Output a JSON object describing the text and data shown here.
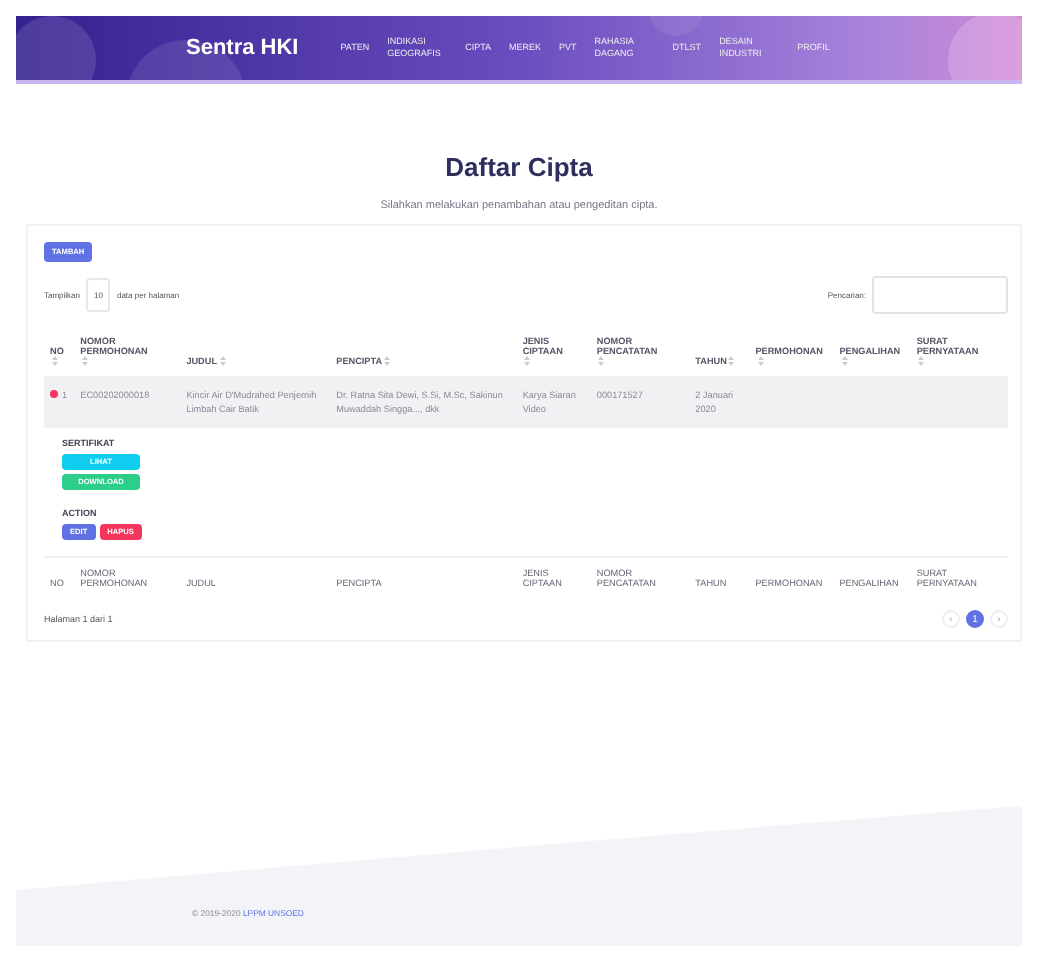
{
  "navbar": {
    "brand": "Sentra HKI",
    "items": [
      {
        "label": "PATEN"
      },
      {
        "label": "INDIKASI GEOGRAFIS"
      },
      {
        "label": "CIPTA"
      },
      {
        "label": "MEREK"
      },
      {
        "label": "PVT"
      },
      {
        "label": "RAHASIA DAGANG"
      },
      {
        "label": "DTLST"
      },
      {
        "label": "DESAIN INDUSTRI"
      },
      {
        "label": "PROFIL"
      }
    ]
  },
  "page": {
    "title": "Daftar Cipta",
    "subtitle": "Silahkan melakukan penambahan atau pengeditan cipta."
  },
  "add_button": "TAMBAH",
  "length_control": {
    "before": "Tampilkan",
    "value": "10",
    "after": "data per halaman"
  },
  "search": {
    "label": "Pencarian:"
  },
  "table": {
    "columns": [
      {
        "label": "NO"
      },
      {
        "label": "NOMOR PERMOHONAN"
      },
      {
        "label": "JUDUL"
      },
      {
        "label": "PENCIPTA"
      },
      {
        "label": "JENIS CIPTAAN"
      },
      {
        "label": "NOMOR PENCATATAN"
      },
      {
        "label": "TAHUN"
      },
      {
        "label": "PERMOHONAN"
      },
      {
        "label": "PENGALIHAN"
      },
      {
        "label": "SURAT PERNYATAAN"
      }
    ],
    "rows": [
      {
        "expanded": true,
        "cells": [
          "1",
          "EC00202000018",
          "Kincir Air D'Mudrahed Penjernih Limbah Cair Batik",
          "Dr. Ratna Sita Dewi, S.Si, M.Sc, Sakinun Muwaddah Singga..., dkk",
          "Karya Siaran Video",
          "000171527",
          "2 Januari 2020",
          "",
          "",
          ""
        ],
        "details": [
          {
            "label": "SERTIFIKAT",
            "buttons": [
              {
                "label": "LIHAT",
                "kind": "info"
              },
              {
                "label": "DOWNLOAD",
                "kind": "success"
              }
            ],
            "kind": "stacked"
          },
          {
            "label": "ACTION",
            "buttons": [
              {
                "label": "EDIT",
                "kind": "primary"
              },
              {
                "label": "HAPUS",
                "kind": "danger"
              }
            ],
            "kind": "inline"
          }
        ]
      }
    ],
    "footer_columns": [
      {
        "label": "NO"
      },
      {
        "label": "NOMOR PERMOHONAN"
      },
      {
        "label": "JUDUL"
      },
      {
        "label": "PENCIPTA"
      },
      {
        "label": "JENIS CIPTAAN"
      },
      {
        "label": "NOMOR PENCATATAN"
      },
      {
        "label": "TAHUN"
      },
      {
        "label": "PERMOHONAN"
      },
      {
        "label": "PENGALIHAN"
      },
      {
        "label": "SURAT PERNYATAAN"
      }
    ]
  },
  "info": "Halaman 1 dari 1",
  "pagination": {
    "prev": "‹",
    "pages": [
      {
        "label": "1",
        "selected": true
      }
    ],
    "next": "›"
  },
  "footer": {
    "text": "© 2019-2020",
    "link": "LPPM UNSOED"
  }
}
